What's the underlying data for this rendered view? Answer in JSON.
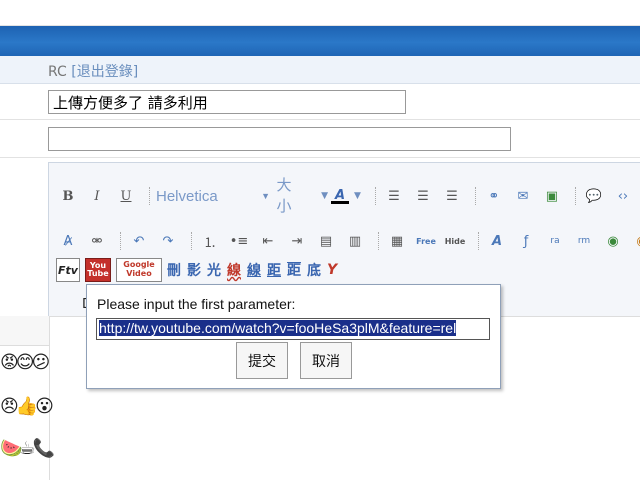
{
  "header": {
    "user": "RC",
    "logout_label": "[退出登錄]"
  },
  "form": {
    "title_value": "上傳方便多了 請多利用",
    "second_value": ""
  },
  "toolbar": {
    "font_name": "Helvetica",
    "font_size": "大小",
    "row3_chars": [
      "刪",
      "影",
      "光",
      "線",
      "線",
      "距",
      "距",
      "底"
    ],
    "youtube_top": "You",
    "youtube_bottom": "Tube",
    "google_top": "Google",
    "google_bottom": "Video",
    "ftv": "Ftv",
    "free": "Free",
    "hide": "Hide"
  },
  "editor": {
    "partial_char": "D"
  },
  "dialog": {
    "prompt": "Please input the first parameter:",
    "value": "http://tw.youtube.com/watch?v=fooHeSa3plM&feature=rel",
    "ok_label": "提交",
    "cancel_label": "取消"
  },
  "colors": {
    "header_blue": "#2b78c8",
    "link_blue": "#6a8ebd",
    "selection": "#1a2f8a"
  }
}
